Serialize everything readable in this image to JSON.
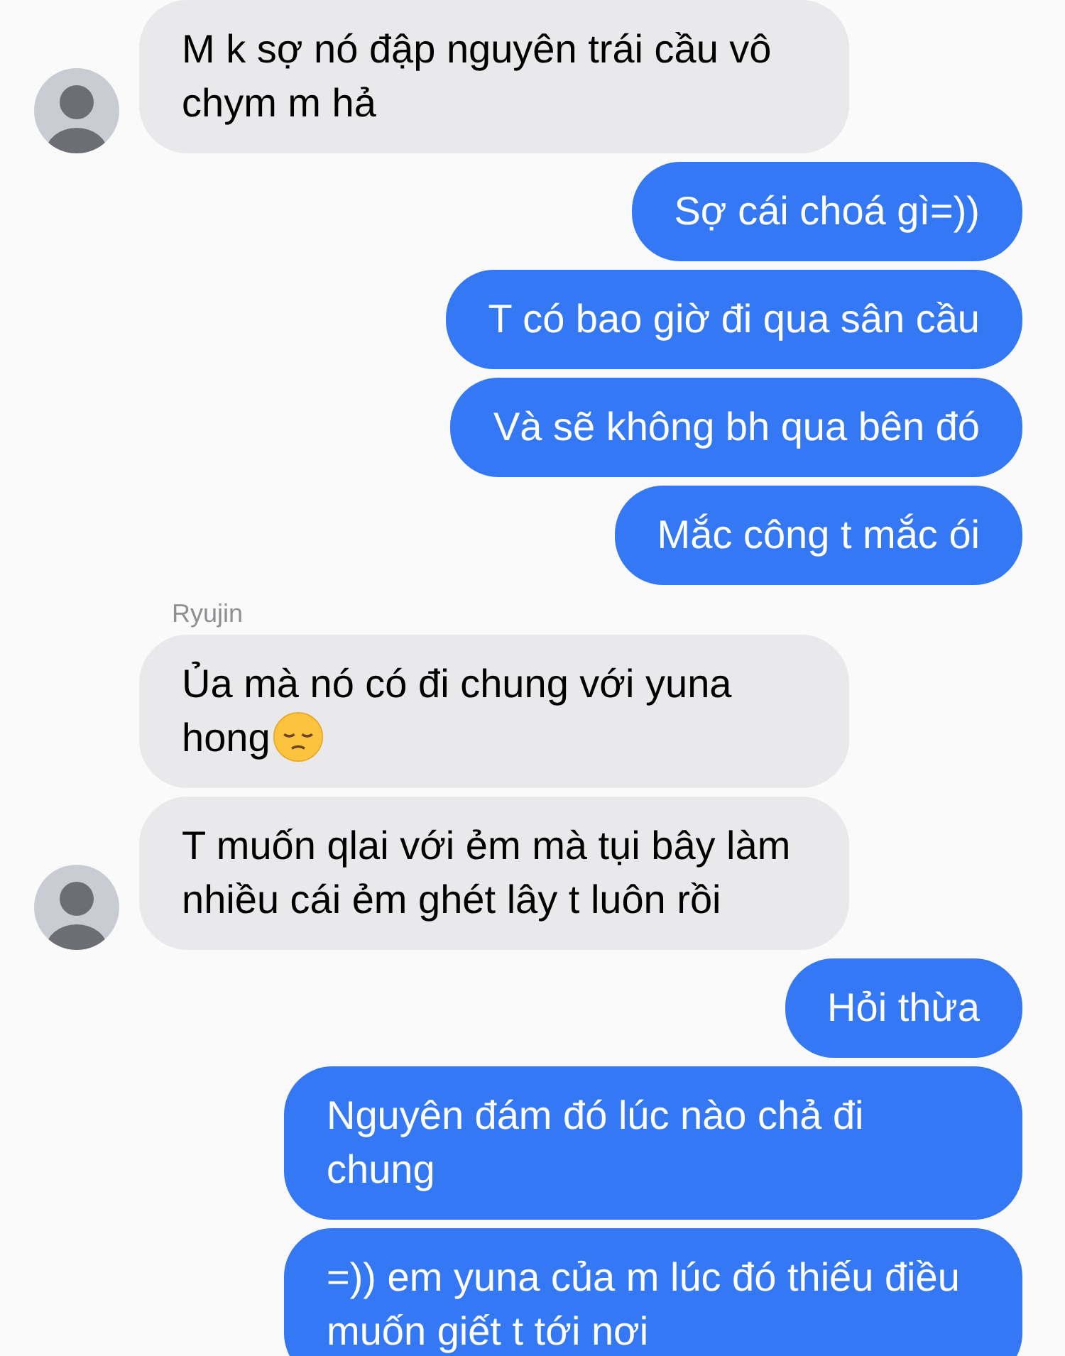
{
  "messages": [
    {
      "kind": "incoming",
      "avatar": true,
      "text": "M k sợ nó đập nguyên trái cầu vô chym m hả"
    },
    {
      "kind": "outgoing",
      "text": "Sợ cái choá gì=))"
    },
    {
      "kind": "outgoing",
      "text": "T có bao giờ đi qua sân cầu"
    },
    {
      "kind": "outgoing",
      "text": "Và sẽ không bh qua bên đó"
    },
    {
      "kind": "outgoing",
      "text": "Mắc công t mắc ói"
    },
    {
      "kind": "incoming",
      "sender": "Ryujin",
      "text": "Ủa mà nó có đi chung với yuna hong",
      "emoji": true
    },
    {
      "kind": "incoming",
      "avatar": true,
      "text": "T muốn qlai với ẻm mà tụi bây làm nhiều cái ẻm ghét lây t luôn rồi"
    },
    {
      "kind": "outgoing",
      "text": "Hỏi thừa"
    },
    {
      "kind": "outgoing",
      "text": "Nguyên đám đó lúc nào chả đi chung"
    },
    {
      "kind": "outgoing",
      "text": "=)) em yuna của m lúc đó thiếu điều muốn giết t tới nơi"
    }
  ]
}
